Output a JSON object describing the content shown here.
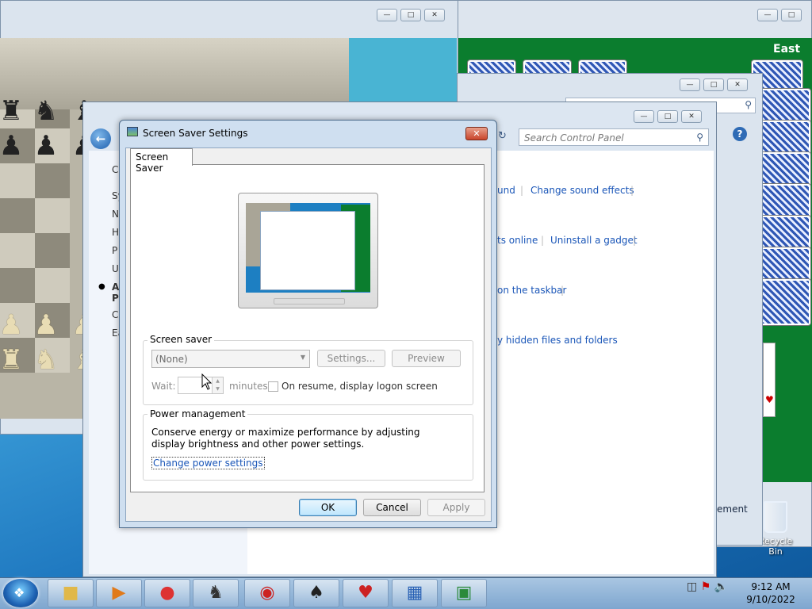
{
  "desktop": {
    "solitaire": {
      "east_label": "East"
    },
    "recycle_bin": {
      "label": "Recycle Bin"
    }
  },
  "control_panel": {
    "search_placeholder": "Search Control Panel",
    "left_letters": [
      "C",
      "Sy",
      "N",
      "H",
      "P",
      "U",
      "A",
      "P",
      "C",
      "Ea"
    ],
    "links": {
      "sound_fragment": "und",
      "change_sound_effects": "Change sound effects",
      "gadgets_fragment": "ts online",
      "uninstall_gadget": "Uninstall a gadget",
      "taskbar_fragment": "on the taskbar",
      "hidden_files_fragment": "y hidden files and folders",
      "ement_fragment": "ement"
    }
  },
  "dialog": {
    "title": "Screen Saver Settings",
    "tab_label": "Screen Saver",
    "screen_saver_group": "Screen saver",
    "screen_saver_value": "(None)",
    "settings_button": "Settings...",
    "preview_button": "Preview",
    "wait_label": "Wait:",
    "minutes_label": "minutes",
    "resume_label": "On resume, display logon screen",
    "power_group": "Power management",
    "power_text": "Conserve energy or maximize performance by adjusting display brightness and other power settings.",
    "power_link": "Change power settings",
    "ok_button": "OK",
    "cancel_button": "Cancel",
    "apply_button": "Apply"
  },
  "taskbar": {
    "time": "9:12 AM",
    "date": "9/10/2022",
    "items": [
      "explorer",
      "media-player",
      "chrome",
      "chess-titans",
      "hearts-game",
      "spider-solitaire",
      "hearts",
      "control-panel",
      "display-settings"
    ]
  }
}
